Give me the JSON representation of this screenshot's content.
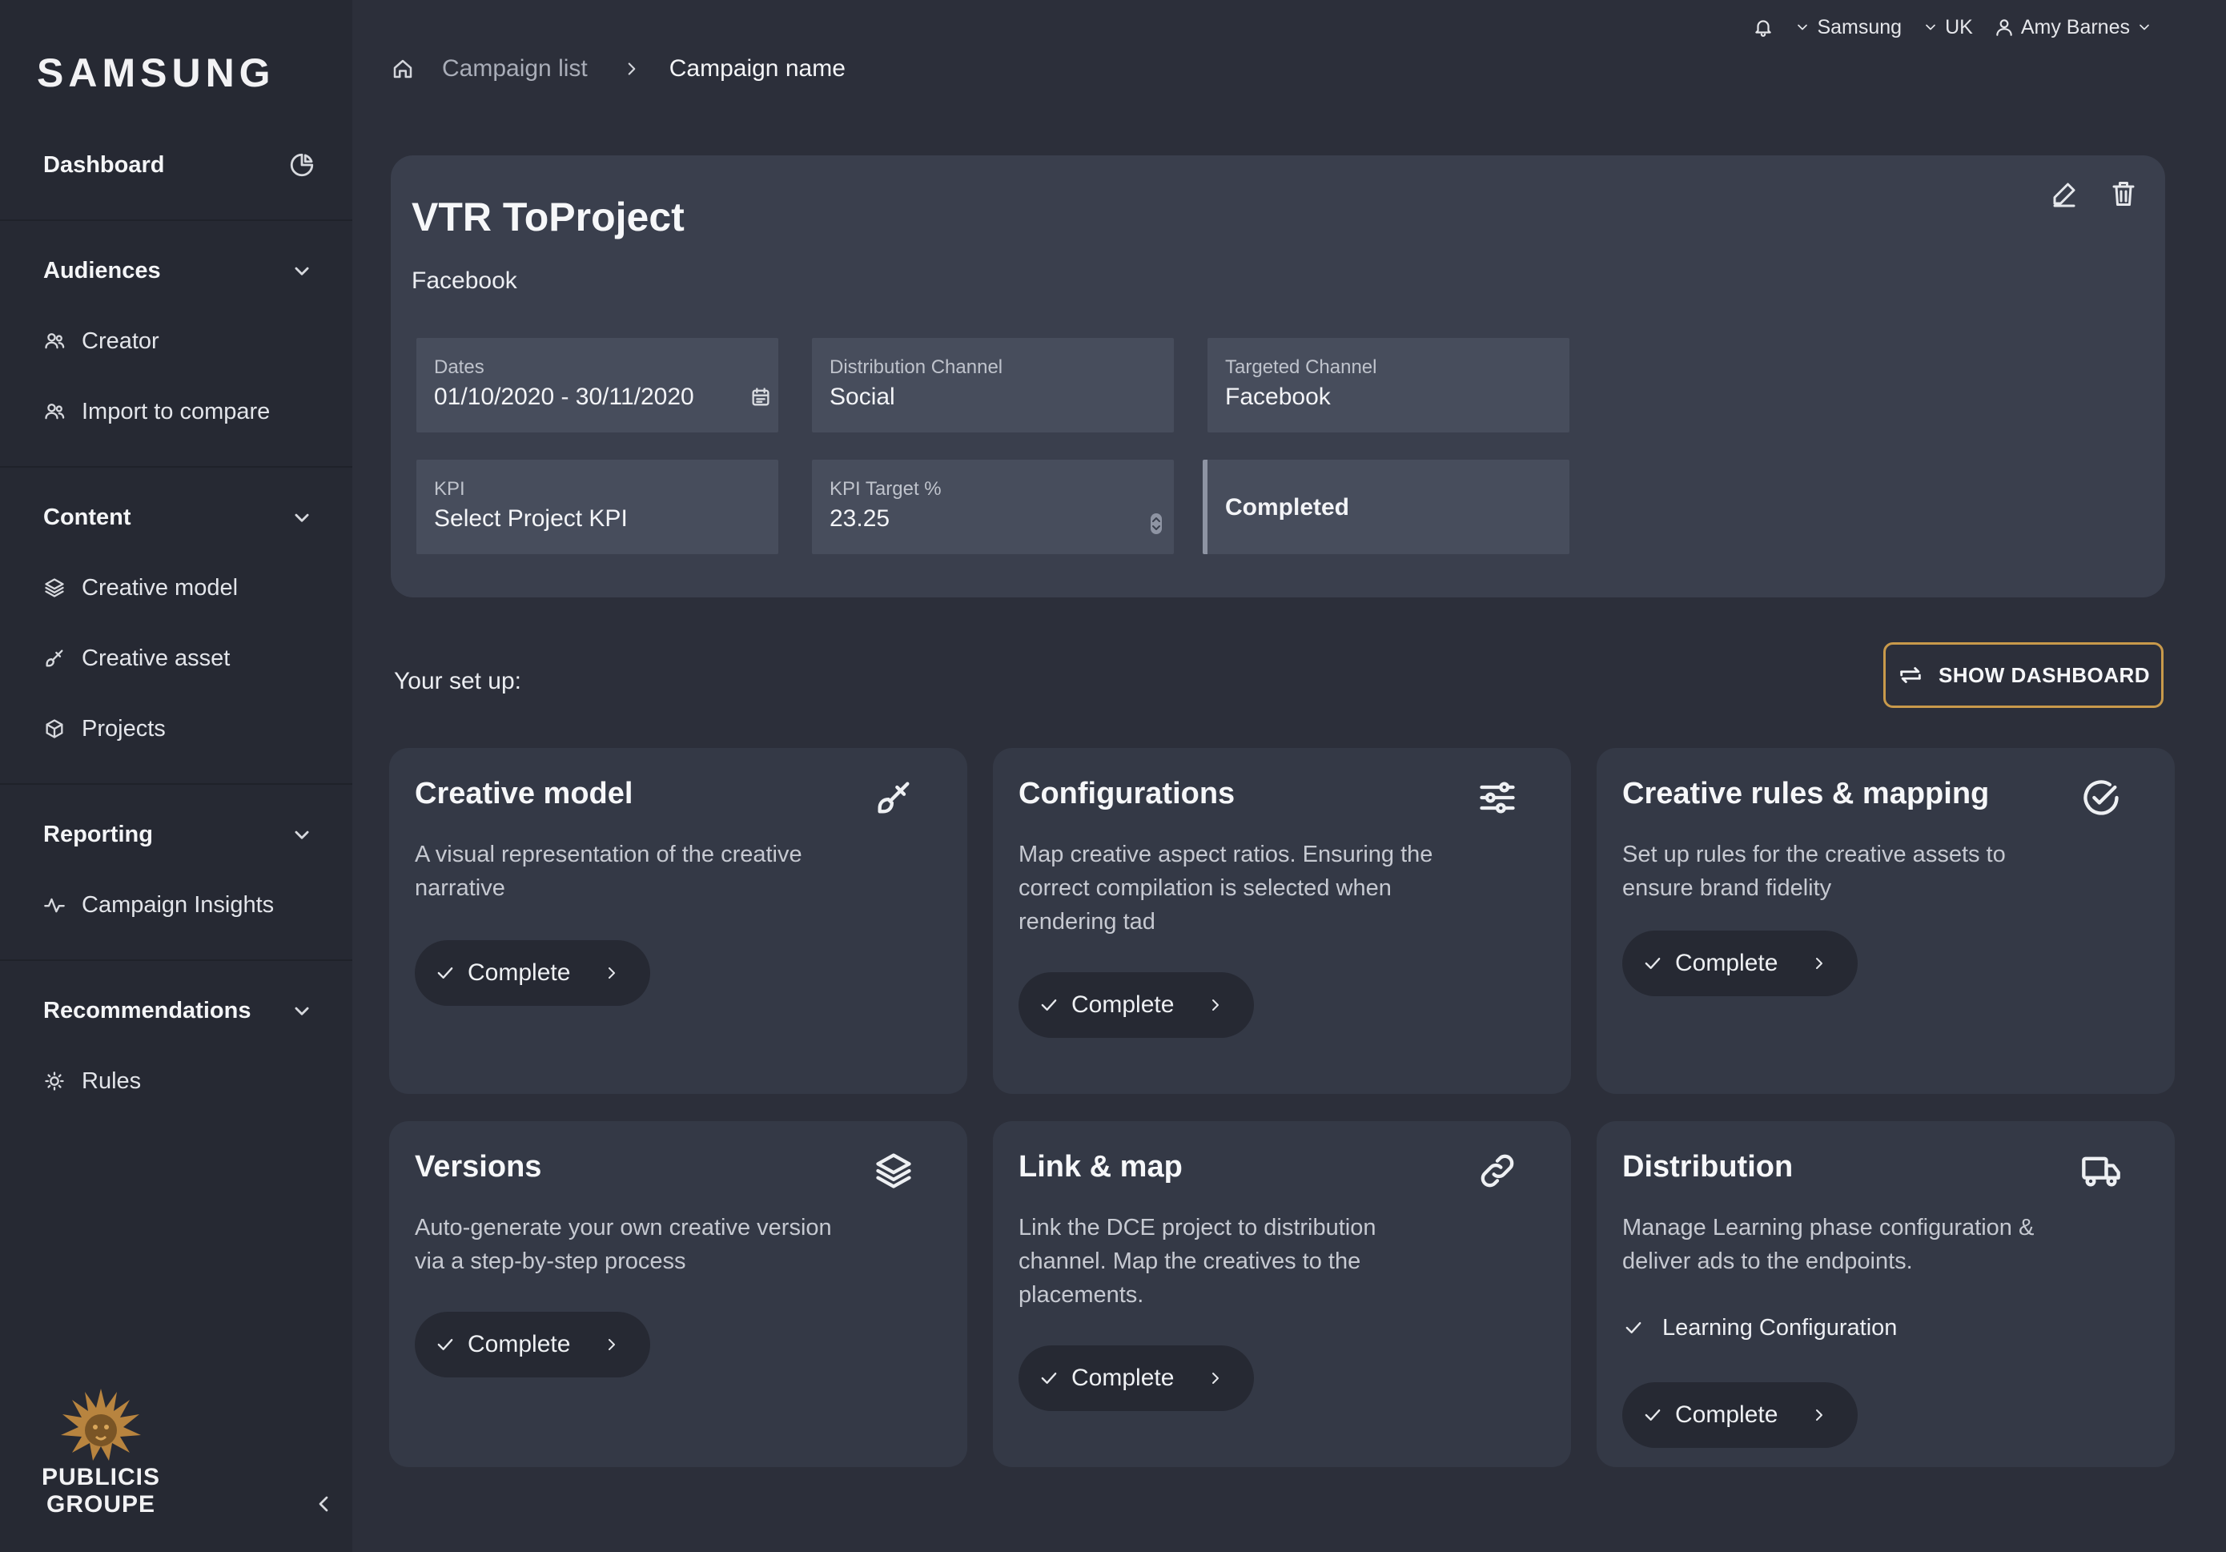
{
  "brand": {
    "logo": "SAMSUNG"
  },
  "sidebar": {
    "dashboard": {
      "label": "Dashboard",
      "icon": "pie-chart-icon"
    },
    "groups": [
      {
        "title": "Audiences",
        "items": [
          {
            "label": "Creator",
            "icon": "users-icon"
          },
          {
            "label": "Import to compare",
            "icon": "users-icon"
          }
        ]
      },
      {
        "title": "Content",
        "items": [
          {
            "label": "Creative model",
            "icon": "layers-icon"
          },
          {
            "label": "Creative asset",
            "icon": "brush-icon"
          },
          {
            "label": "Projects",
            "icon": "box-icon"
          }
        ]
      },
      {
        "title": "Reporting",
        "items": [
          {
            "label": "Campaign Insights",
            "icon": "activity-icon"
          }
        ]
      },
      {
        "title": "Recommendations",
        "items": [
          {
            "label": "Rules",
            "icon": "lightbulb-icon"
          }
        ]
      }
    ],
    "footer_logo": {
      "line1": "PUBLICIS",
      "line2": "GROUPE"
    }
  },
  "topbar": {
    "account": "Samsung",
    "region": "UK",
    "user": "Amy Barnes"
  },
  "breadcrumb": {
    "parent": "Campaign list",
    "current": "Campaign name"
  },
  "campaign": {
    "title": "VTR ToProject",
    "subtitle": "Facebook",
    "fields": {
      "dates": {
        "label": "Dates",
        "value": "01/10/2020 - 30/11/2020"
      },
      "distribution": {
        "label": "Distribution Channel",
        "value": "Social"
      },
      "targeted": {
        "label": "Targeted Channel",
        "value": "Facebook"
      },
      "kpi": {
        "label": "KPI",
        "value": "Select Project KPI"
      },
      "kpi_target": {
        "label": "KPI Target %",
        "value": "23.25"
      },
      "status": {
        "value": "Completed"
      }
    }
  },
  "setup": {
    "label": "Your set up:",
    "show_dashboard": "SHOW DASHBOARD",
    "cards": [
      {
        "title": "Creative model",
        "desc": "A visual representation of the creative narrative",
        "action": "Complete",
        "icon": "brush-icon"
      },
      {
        "title": "Configurations",
        "desc": "Map creative aspect ratios. Ensuring the correct compilation is selected when rendering tad",
        "action": "Complete",
        "icon": "sliders-icon"
      },
      {
        "title": "Creative rules & mapping",
        "desc": "Set up rules for the creative assets to ensure brand fidelity",
        "action": "Complete",
        "icon": "check-circle-icon"
      },
      {
        "title": "Versions",
        "desc": "Auto-generate your own creative version via a step-by-step process",
        "action": "Complete",
        "icon": "layers-icon"
      },
      {
        "title": "Link & map",
        "desc": "Link the DCE project to distribution channel. Map the creatives to the placements.",
        "action": "Complete",
        "icon": "link-icon"
      },
      {
        "title": "Distribution",
        "desc": "Manage Learning phase configuration & deliver ads to the endpoints.",
        "checklist": "Learning Configuration",
        "action": "Complete",
        "icon": "truck-icon"
      }
    ]
  },
  "colors": {
    "background": "#2c2f3a",
    "sidebar": "#262933",
    "panel": "#3a3f4d",
    "card": "#343946",
    "accent_gold": "#c99a4b"
  }
}
